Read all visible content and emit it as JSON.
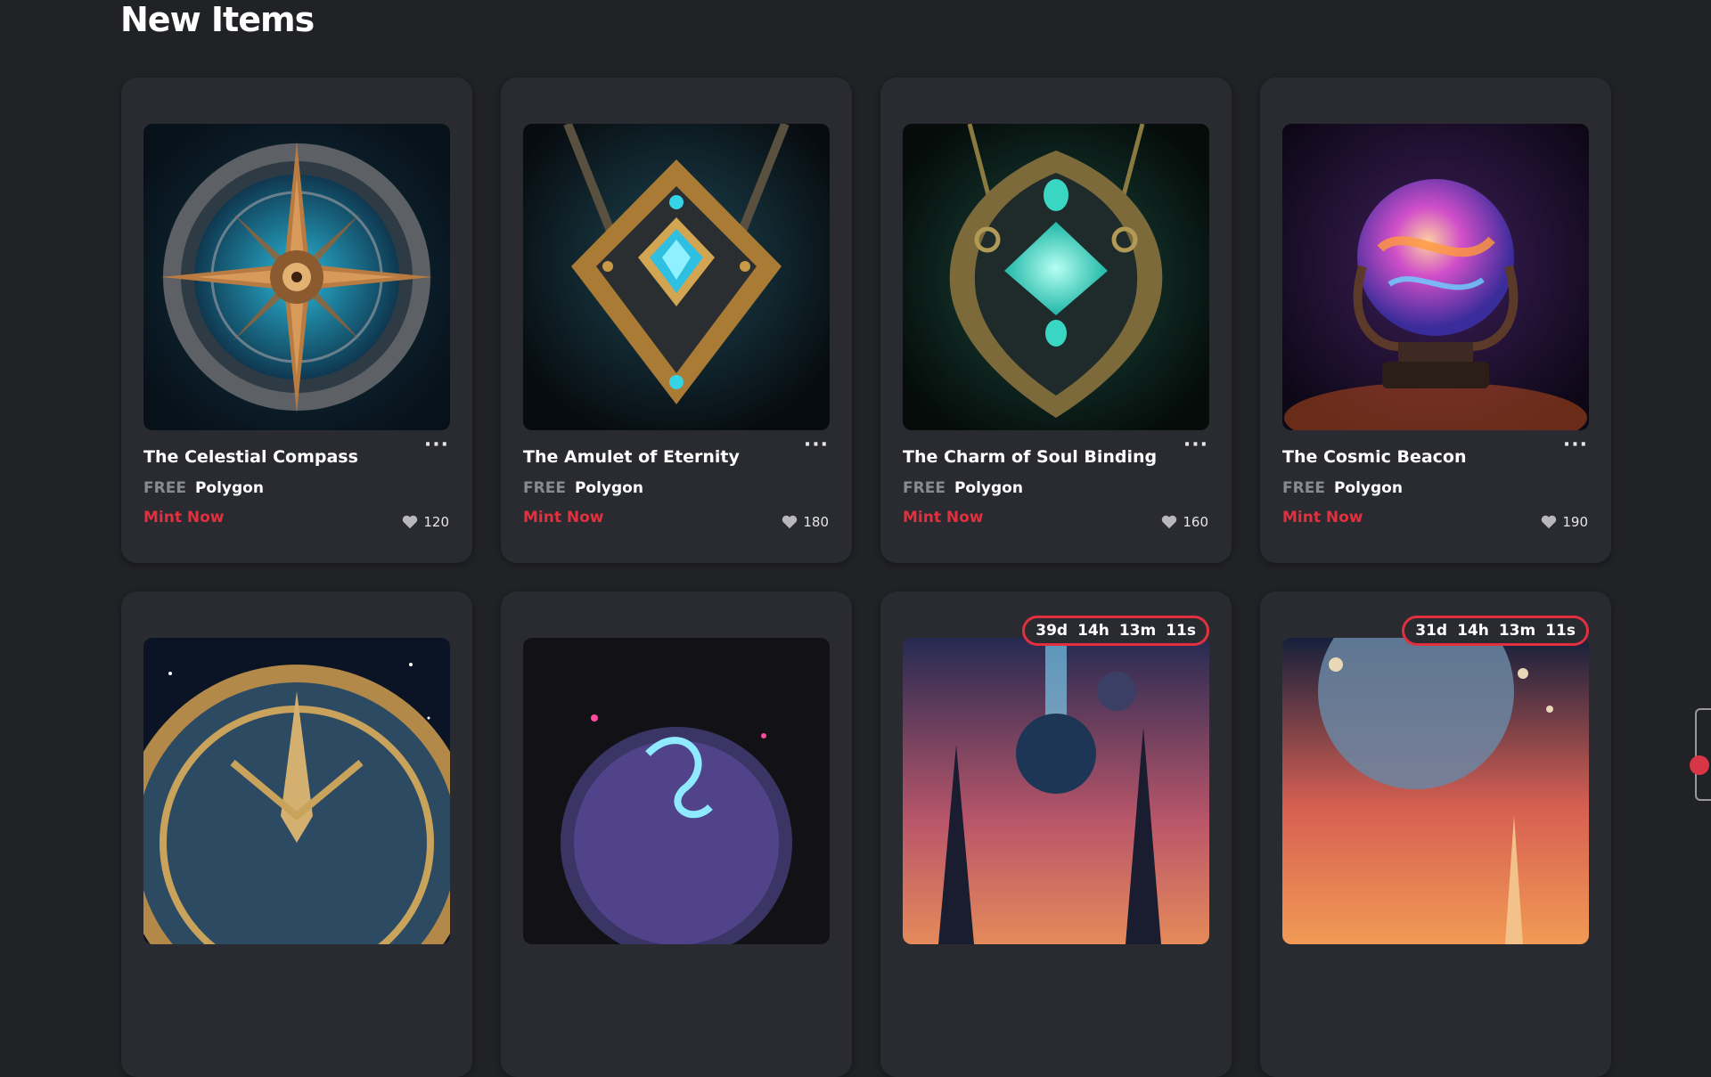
{
  "section": {
    "title": "New Items"
  },
  "accent_color": "#e3303f",
  "cards": [
    {
      "name": "The Celestial Compass",
      "price": "FREE",
      "chain": "Polygon",
      "cta": "Mint Now",
      "likes": "120",
      "more": "···"
    },
    {
      "name": "The Amulet of Eternity",
      "price": "FREE",
      "chain": "Polygon",
      "cta": "Mint Now",
      "likes": "180",
      "more": "···"
    },
    {
      "name": "The Charm of Soul Binding",
      "price": "FREE",
      "chain": "Polygon",
      "cta": "Mint Now",
      "likes": "160",
      "more": "···"
    },
    {
      "name": "The Cosmic Beacon",
      "price": "FREE",
      "chain": "Polygon",
      "cta": "Mint Now",
      "likes": "190",
      "more": "···"
    }
  ],
  "row2": [
    {
      "timer": null
    },
    {
      "timer": null
    },
    {
      "timer": {
        "d": "39d",
        "h": "14h",
        "m": "13m",
        "s": "11s"
      }
    },
    {
      "timer": {
        "d": "31d",
        "h": "14h",
        "m": "13m",
        "s": "11s"
      }
    }
  ]
}
